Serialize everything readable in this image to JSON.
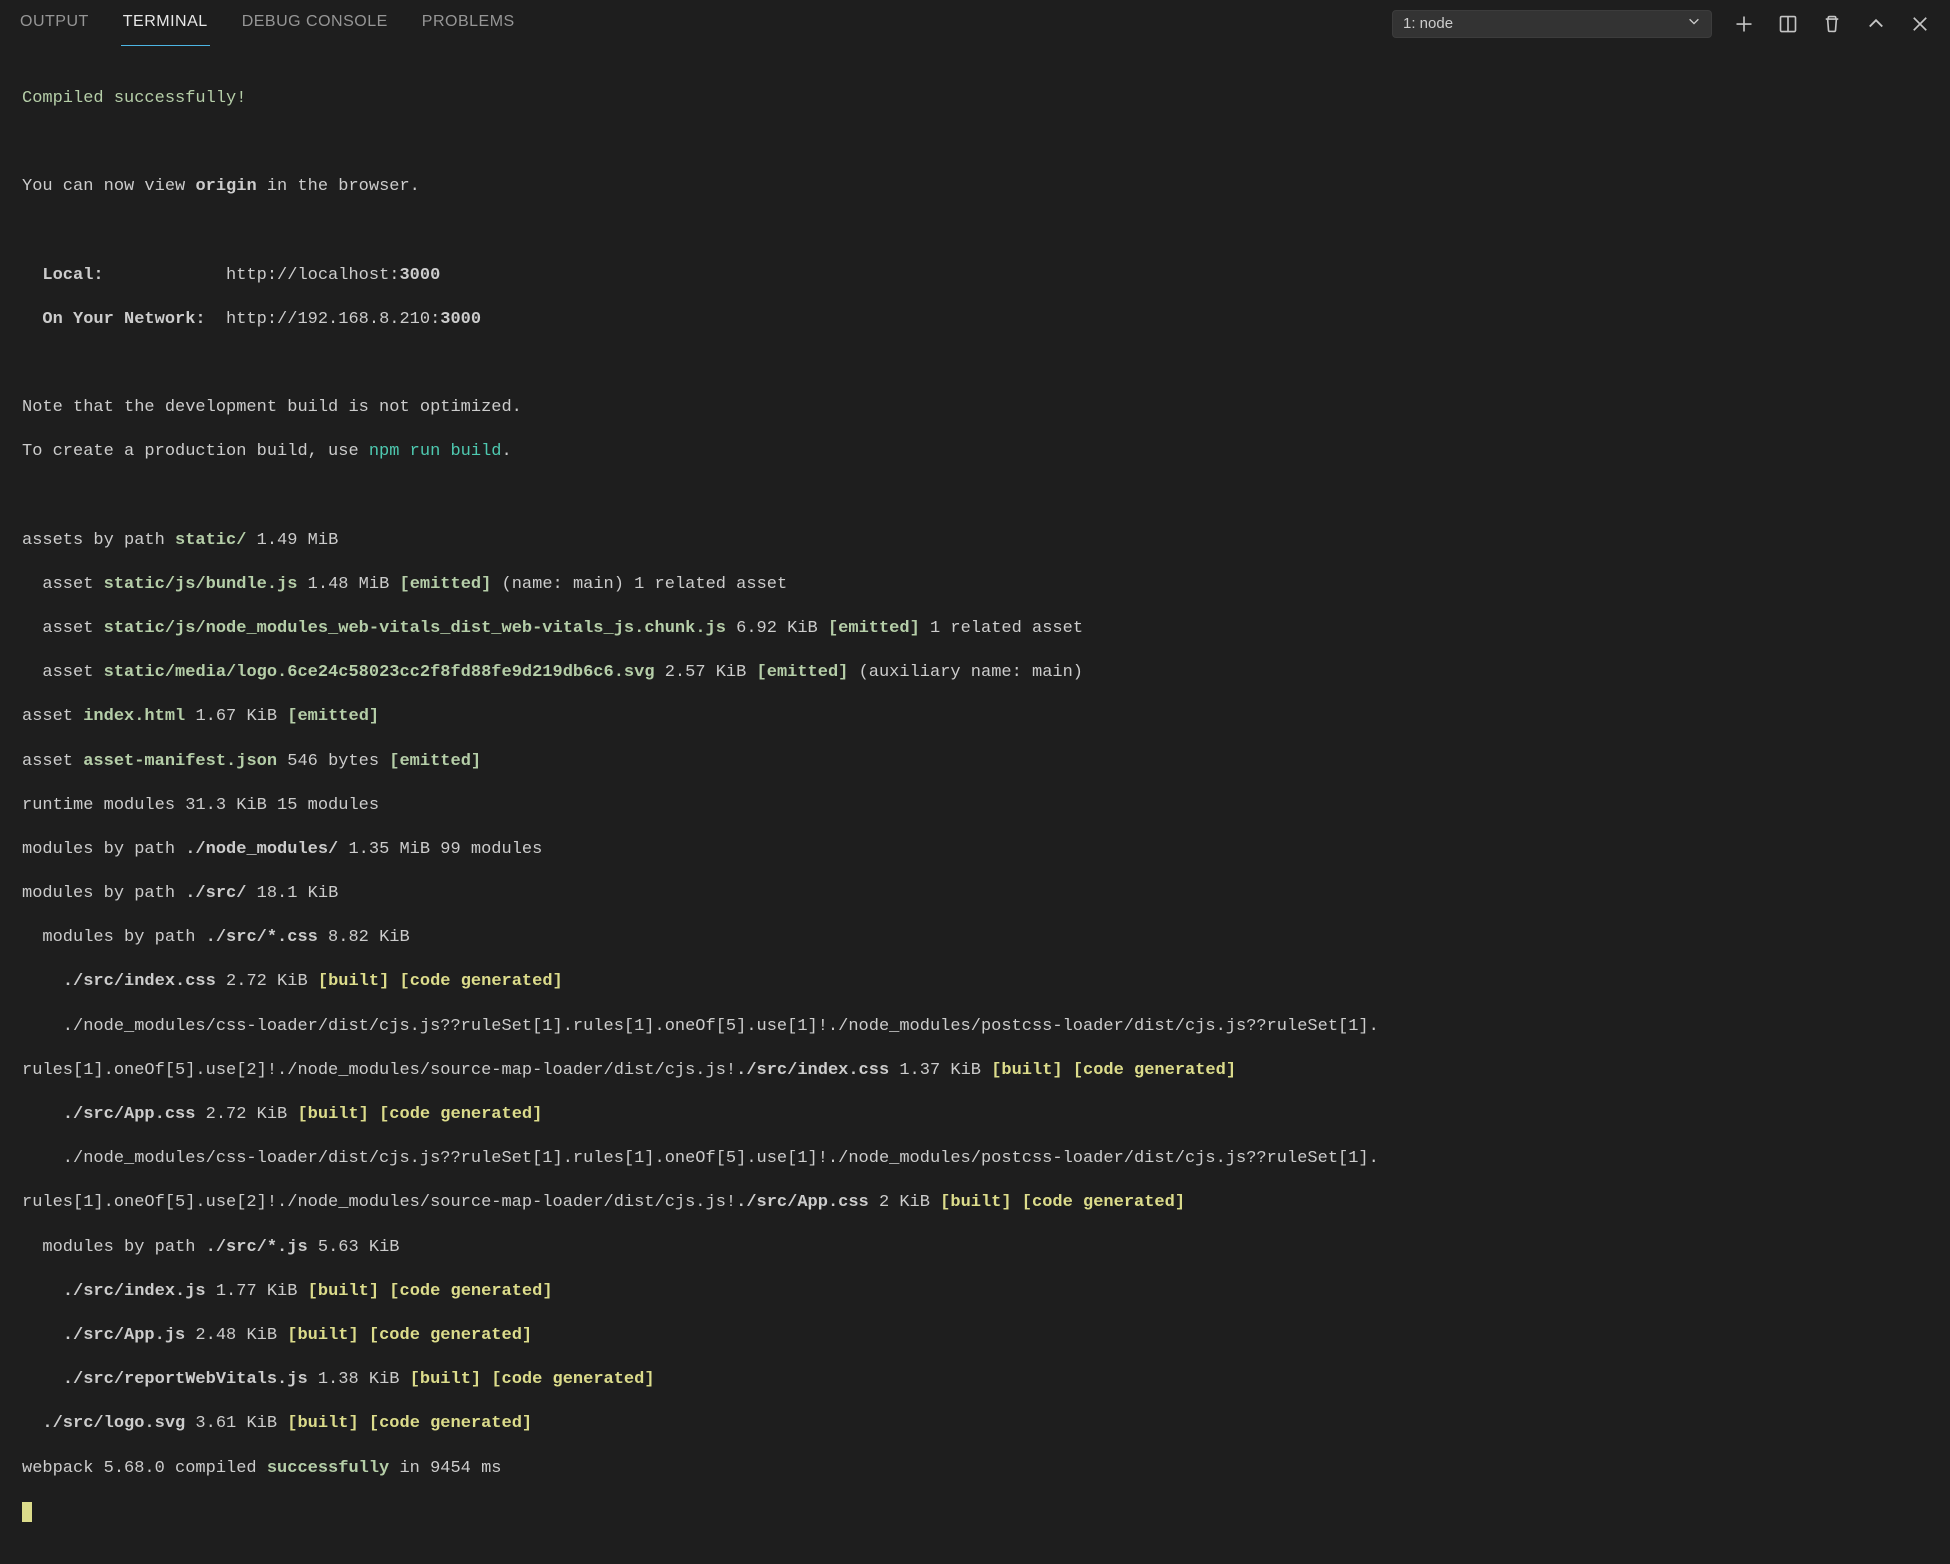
{
  "tabs": {
    "output": "OUTPUT",
    "terminal": "TERMINAL",
    "debug_console": "DEBUG CONSOLE",
    "problems": "PROBLEMS"
  },
  "dropdown": {
    "selected": "1: node"
  },
  "term": {
    "compiled": "Compiled successfully!",
    "view_pre": "You can now view ",
    "view_app": "origin",
    "view_post": " in the browser.",
    "local_label": "  Local:           ",
    "local_url_pre": " http://localhost:",
    "local_url_port": "3000",
    "net_label": "  On Your Network: ",
    "net_url_pre": " http://192.168.8.210:",
    "net_url_port": "3000",
    "note1": "Note that the development build is not optimized.",
    "note2_pre": "To create a production build, use ",
    "note2_cmd": "npm run build",
    "note2_post": ".",
    "a1_pre": "assets by path ",
    "a1_path": "static/",
    "a1_size": " 1.49 MiB",
    "a2_pre": "  asset ",
    "a2_path": "static/js/bundle.js",
    "a2_size": " 1.48 MiB ",
    "a2_tag": "[emitted]",
    "a2_post": " (name: main) 1 related asset",
    "a3_pre": "  asset ",
    "a3_path": "static/js/node_modules_web-vitals_dist_web-vitals_js.chunk.js",
    "a3_size": " 6.92 KiB ",
    "a3_tag": "[emitted]",
    "a3_post": " 1 related asset",
    "a4_pre": "  asset ",
    "a4_path": "static/media/logo.6ce24c58023cc2f8fd88fe9d219db6c6.svg",
    "a4_size": " 2.57 KiB ",
    "a4_tag": "[emitted]",
    "a4_post": " (auxiliary name: main)",
    "a5_pre": "asset ",
    "a5_path": "index.html",
    "a5_size": " 1.67 KiB ",
    "a5_tag": "[emitted]",
    "a6_pre": "asset ",
    "a6_path": "asset-manifest.json",
    "a6_size": " 546 bytes ",
    "a6_tag": "[emitted]",
    "rt": "runtime modules 31.3 KiB 15 modules",
    "m1_pre": "modules by path ",
    "m1_path": "./node_modules/",
    "m1_post": " 1.35 MiB 99 modules",
    "m2_pre": "modules by path ",
    "m2_path": "./src/",
    "m2_post": " 18.1 KiB",
    "m3_pre": "  modules by path ",
    "m3_path": "./src/*.css",
    "m3_post": " 8.82 KiB",
    "m4_pre": "    ",
    "m4_path": "./src/index.css",
    "m4_size": " 2.72 KiB ",
    "m4_b": "[built]",
    "m4_sp": " ",
    "m4_c": "[code generated]",
    "m5a": "    ./node_modules/css-loader/dist/cjs.js??ruleSet[1].rules[1].oneOf[5].use[1]!./node_modules/postcss-loader/dist/cjs.js??ruleSet[1].",
    "m5b_pre": "rules[1].oneOf[5].use[2]!./node_modules/source-map-loader/dist/cjs.js!",
    "m5b_path": "./src/index.css",
    "m5b_size": " 1.37 KiB ",
    "m5b_b": "[built]",
    "m5b_sp": " ",
    "m5b_c": "[code generated]",
    "m6_pre": "    ",
    "m6_path": "./src/App.css",
    "m6_size": " 2.72 KiB ",
    "m6_b": "[built]",
    "m6_sp": " ",
    "m6_c": "[code generated]",
    "m7a": "    ./node_modules/css-loader/dist/cjs.js??ruleSet[1].rules[1].oneOf[5].use[1]!./node_modules/postcss-loader/dist/cjs.js??ruleSet[1].",
    "m7b_pre": "rules[1].oneOf[5].use[2]!./node_modules/source-map-loader/dist/cjs.js!",
    "m7b_path": "./src/App.css",
    "m7b_size": " 2 KiB ",
    "m7b_b": "[built]",
    "m7b_sp": " ",
    "m7b_c": "[code generated]",
    "m8_pre": "  modules by path ",
    "m8_path": "./src/*.js",
    "m8_post": " 5.63 KiB",
    "m9_pre": "    ",
    "m9_path": "./src/index.js",
    "m9_size": " 1.77 KiB ",
    "m9_b": "[built]",
    "m9_sp": " ",
    "m9_c": "[code generated]",
    "m10_pre": "    ",
    "m10_path": "./src/App.js",
    "m10_size": " 2.48 KiB ",
    "m10_b": "[built]",
    "m10_sp": " ",
    "m10_c": "[code generated]",
    "m11_pre": "    ",
    "m11_path": "./src/reportWebVitals.js",
    "m11_size": " 1.38 KiB ",
    "m11_b": "[built]",
    "m11_sp": " ",
    "m11_c": "[code generated]",
    "m12_pre": "  ",
    "m12_path": "./src/logo.svg",
    "m12_size": " 3.61 KiB ",
    "m12_b": "[built]",
    "m12_sp": " ",
    "m12_c": "[code generated]",
    "wp_pre": "webpack 5.68.0 compiled ",
    "wp_ok": "successfully",
    "wp_post": " in 9454 ms"
  }
}
